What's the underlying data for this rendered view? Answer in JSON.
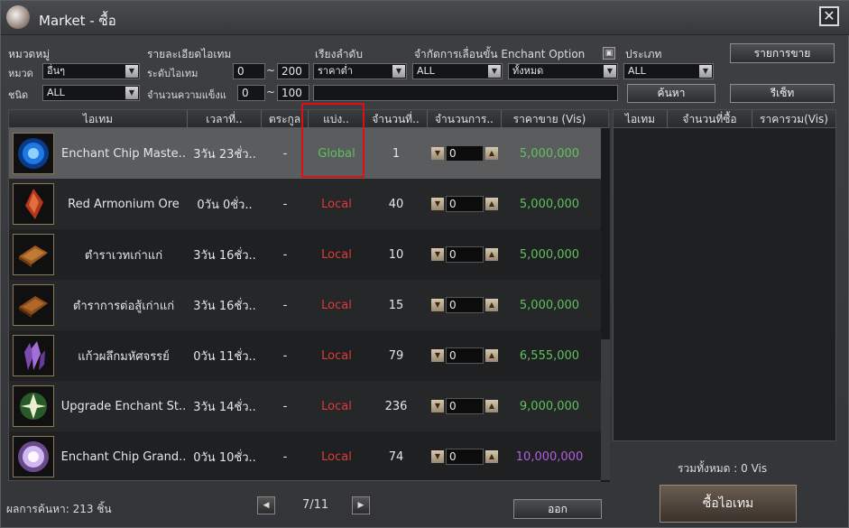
{
  "window": {
    "title": "Market - ซื้อ",
    "close_glyph": "✕"
  },
  "filters": {
    "category_group_label": "หมวดหมู่",
    "category_label": "หมวด",
    "category_value": "อื่นๆ",
    "type_label": "ชนิด",
    "type_value": "ALL",
    "item_detail_label": "รายละเอียดไอเทม",
    "item_level_label": "ระดับไอเทม",
    "item_level_min": "0",
    "item_level_max": "200",
    "durability_label": "จำนวนความแข็งแ",
    "durability_min": "0",
    "durability_max": "100",
    "range_sep": "~",
    "sort_label": "เรียงลำดับ",
    "sort_value": "ราคาต่ำ",
    "enchant_limit_label": "จำกัดการเลื่อนขั้น Enchant Option",
    "enchant_value": "ALL",
    "enchant_option_value": "ทั้งหมด",
    "kind_label": "ประเภท",
    "kind_value": "ALL",
    "help_glyph": "▣"
  },
  "buttons": {
    "sell_list": "รายการขาย",
    "search": "ค้นหา",
    "reset": "รีเซ็ท",
    "exit": "ออก",
    "buy": "ซื้อไอเทม"
  },
  "table": {
    "headers": [
      "ไอเทม",
      "เวลาที่..",
      "ตระกูล",
      "แบ่ง..",
      "จำนวนที่..",
      "จำนวนการ..",
      "ราคาขาย (Vis)"
    ],
    "rows": [
      {
        "icon": "enchant-chip-master-icon",
        "name": "Enchant Chip Maste..",
        "time": "3วัน 23ชั่ว..",
        "family": "-",
        "region": "Global",
        "region_color": "green",
        "count": "1",
        "qty": "0",
        "price": "5,000,000",
        "price_color": "green",
        "selected": true
      },
      {
        "icon": "red-armonium-ore-icon",
        "name": "Red Armonium Ore",
        "time": "0วัน 0ชั่ว..",
        "family": "-",
        "region": "Local",
        "region_color": "red",
        "count": "40",
        "qty": "0",
        "price": "5,000,000",
        "price_color": "green",
        "selected": false
      },
      {
        "icon": "ancient-spellbook-icon",
        "name": "ตำราเวทเก่าแก่",
        "time": "3วัน 16ชั่ว..",
        "family": "-",
        "region": "Local",
        "region_color": "red",
        "count": "10",
        "qty": "0",
        "price": "5,000,000",
        "price_color": "green",
        "selected": false
      },
      {
        "icon": "ancient-combat-book-icon",
        "name": "ตำราการต่อสู้เก่าแก่",
        "time": "3วัน 16ชั่ว..",
        "family": "-",
        "region": "Local",
        "region_color": "red",
        "count": "15",
        "qty": "0",
        "price": "5,000,000",
        "price_color": "green",
        "selected": false
      },
      {
        "icon": "magic-crystal-icon",
        "name": "แก้วผลึกมหัศจรรย์",
        "time": "0วัน 11ชั่ว..",
        "family": "-",
        "region": "Local",
        "region_color": "red",
        "count": "79",
        "qty": "0",
        "price": "6,555,000",
        "price_color": "green",
        "selected": false
      },
      {
        "icon": "upgrade-enchant-stone-icon",
        "name": "Upgrade Enchant St..",
        "time": "3วัน 14ชั่ว..",
        "family": "-",
        "region": "Local",
        "region_color": "red",
        "count": "236",
        "qty": "0",
        "price": "9,000,000",
        "price_color": "green",
        "selected": false
      },
      {
        "icon": "enchant-chip-grand-icon",
        "name": "Enchant Chip Grand..",
        "time": "0วัน 10ชั่ว..",
        "family": "-",
        "region": "Local",
        "region_color": "red",
        "count": "74",
        "qty": "0",
        "price": "10,000,000",
        "price_color": "purple",
        "selected": false
      }
    ]
  },
  "cart": {
    "headers": [
      "ไอเทม",
      "จำนวนที่ซื้อ",
      "ราคารวม(Vis)"
    ],
    "total_label": "รวมทั้งหมด : 0 Vis"
  },
  "footer": {
    "results_label": "ผลการค้นหา: 213 ชิ้น",
    "page": "7/11",
    "prev_glyph": "◀",
    "next_glyph": "▶"
  },
  "colors": {
    "green": "#5ec25e",
    "red": "#e03a3a",
    "purple": "#b060e0",
    "highlight": "#e01010"
  }
}
